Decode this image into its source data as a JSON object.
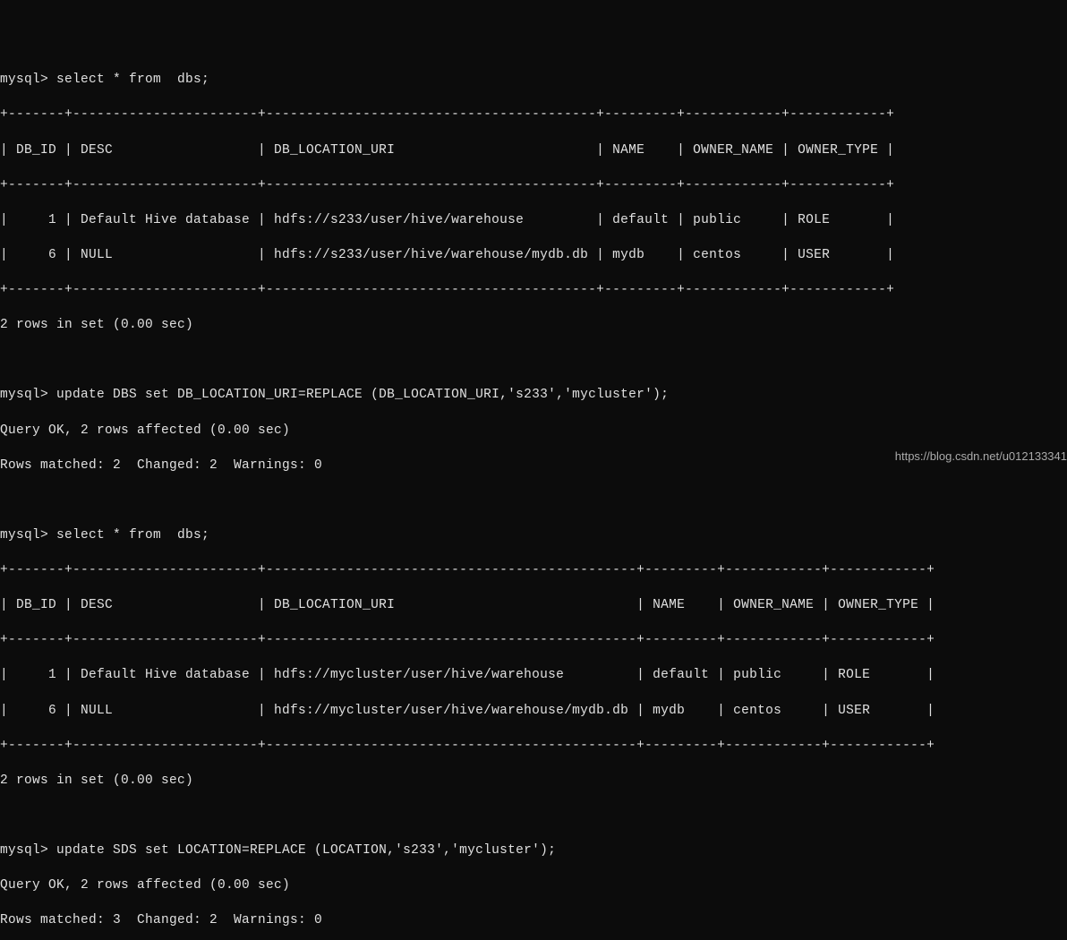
{
  "block1": {
    "prompt": "mysql> select * from  dbs;",
    "sep": "+-------+-----------------------+-----------------------------------------+---------+------------+------------+",
    "header": "| DB_ID | DESC                  | DB_LOCATION_URI                         | NAME    | OWNER_NAME | OWNER_TYPE |",
    "row1": "|     1 | Default Hive database | hdfs://s233/user/hive/warehouse         | default | public     | ROLE       |",
    "row2": "|     6 | NULL                  | hdfs://s233/user/hive/warehouse/mydb.db | mydb    | centos     | USER       |",
    "footer": "2 rows in set (0.00 sec)"
  },
  "update1": {
    "prompt": "mysql> update DBS set DB_LOCATION_URI=REPLACE (DB_LOCATION_URI,'s233','mycluster');",
    "result1": "Query OK, 2 rows affected (0.00 sec)",
    "result2": "Rows matched: 2  Changed: 2  Warnings: 0"
  },
  "block2": {
    "prompt": "mysql> select * from  dbs;",
    "sep": "+-------+-----------------------+----------------------------------------------+---------+------------+------------+",
    "header": "| DB_ID | DESC                  | DB_LOCATION_URI                              | NAME    | OWNER_NAME | OWNER_TYPE |",
    "row1": "|     1 | Default Hive database | hdfs://mycluster/user/hive/warehouse         | default | public     | ROLE       |",
    "row2": "|     6 | NULL                  | hdfs://mycluster/user/hive/warehouse/mydb.db | mydb    | centos     | USER       |",
    "footer": "2 rows in set (0.00 sec)"
  },
  "update2": {
    "prompt": "mysql> update SDS set LOCATION=REPLACE (LOCATION,'s233','mycluster');",
    "result1": "Query OK, 2 rows affected (0.00 sec)",
    "result2": "Rows matched: 3  Changed: 2  Warnings: 0"
  },
  "watermark": "https://blog.csdn.net/u012133341"
}
